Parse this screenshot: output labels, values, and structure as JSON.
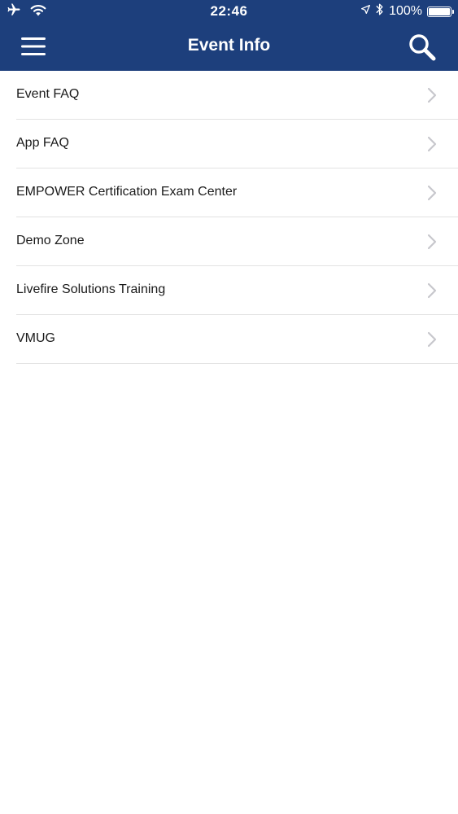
{
  "status_bar": {
    "time": "22:46",
    "battery_text": "100%",
    "battery_level": 1.0,
    "icons": [
      "airplane-icon",
      "wifi-icon",
      "location-arrow-icon",
      "bluetooth-icon",
      "battery-icon"
    ]
  },
  "nav": {
    "title": "Event Info",
    "menu_icon": "hamburger-menu-icon",
    "search_icon": "search-icon"
  },
  "list": {
    "items": [
      {
        "label": "Event FAQ"
      },
      {
        "label": "App FAQ"
      },
      {
        "label": "EMPOWER Certification Exam Center"
      },
      {
        "label": "Demo Zone"
      },
      {
        "label": "Livefire Solutions Training"
      },
      {
        "label": "VMUG"
      }
    ],
    "chevron_icon": "chevron-right-icon"
  },
  "colors": {
    "header_background": "#1d3f7c",
    "header_text": "#ffffff",
    "list_text": "#1a1a1a",
    "divider": "#e2e2e2",
    "chevron": "#c7c7cc"
  }
}
